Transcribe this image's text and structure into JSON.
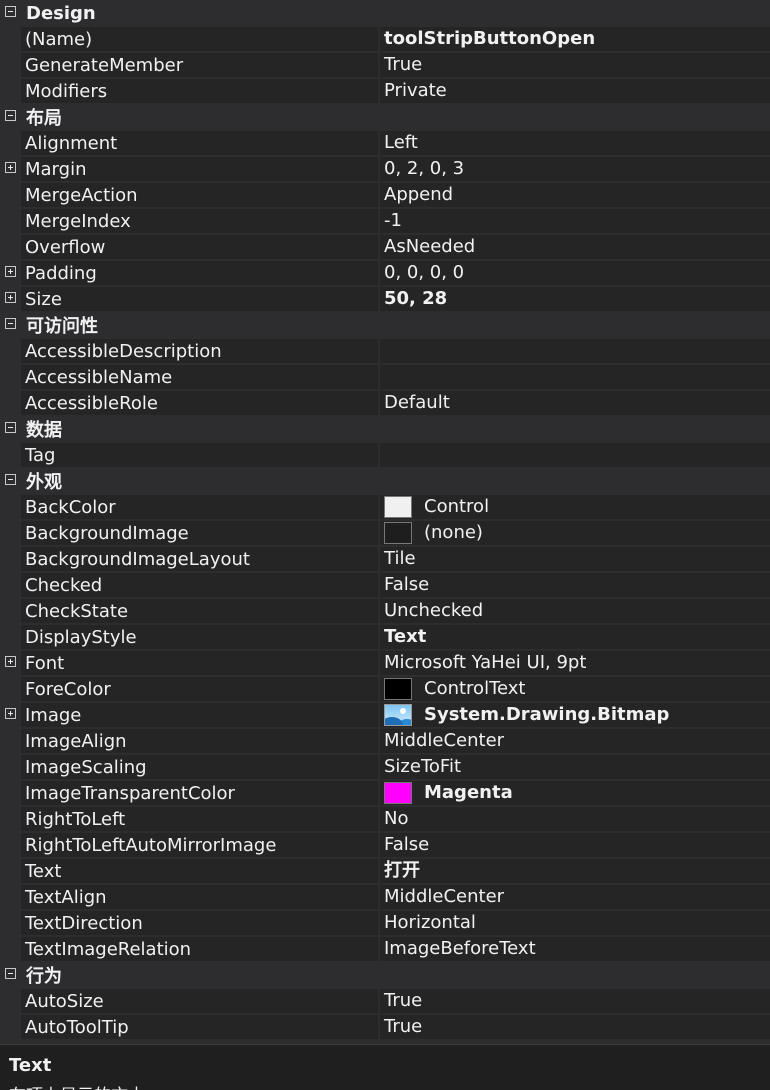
{
  "categories": [
    {
      "label": "Design",
      "props": [
        {
          "name": "(Name)",
          "value": "toolStripButtonOpen",
          "bold": true
        },
        {
          "name": "GenerateMember",
          "value": "True"
        },
        {
          "name": "Modifiers",
          "value": "Private"
        }
      ]
    },
    {
      "label": "布局",
      "props": [
        {
          "name": "Alignment",
          "value": "Left"
        },
        {
          "name": "Margin",
          "value": "0, 2, 0, 3",
          "expandable": true
        },
        {
          "name": "MergeAction",
          "value": "Append"
        },
        {
          "name": "MergeIndex",
          "value": "-1"
        },
        {
          "name": "Overflow",
          "value": "AsNeeded"
        },
        {
          "name": "Padding",
          "value": "0, 0, 0, 0",
          "expandable": true
        },
        {
          "name": "Size",
          "value": "50, 28",
          "bold": true,
          "expandable": true
        }
      ]
    },
    {
      "label": "可访问性",
      "props": [
        {
          "name": "AccessibleDescription",
          "value": ""
        },
        {
          "name": "AccessibleName",
          "value": ""
        },
        {
          "name": "AccessibleRole",
          "value": "Default"
        }
      ]
    },
    {
      "label": "数据",
      "props": [
        {
          "name": "Tag",
          "value": ""
        }
      ]
    },
    {
      "label": "外观",
      "props": [
        {
          "name": "BackColor",
          "value": "Control",
          "swatch": "#f0f0f0"
        },
        {
          "name": "BackgroundImage",
          "value": "(none)",
          "swatch": "#1e1e1e"
        },
        {
          "name": "BackgroundImageLayout",
          "value": "Tile"
        },
        {
          "name": "Checked",
          "value": "False"
        },
        {
          "name": "CheckState",
          "value": "Unchecked"
        },
        {
          "name": "DisplayStyle",
          "value": "Text",
          "bold": true
        },
        {
          "name": "Font",
          "value": "Microsoft YaHei UI, 9pt",
          "expandable": true
        },
        {
          "name": "ForeColor",
          "value": "ControlText",
          "swatch": "#000000"
        },
        {
          "name": "Image",
          "value": "System.Drawing.Bitmap",
          "bold": true,
          "expandable": true,
          "icon": "bitmap-icon"
        },
        {
          "name": "ImageAlign",
          "value": "MiddleCenter"
        },
        {
          "name": "ImageScaling",
          "value": "SizeToFit"
        },
        {
          "name": "ImageTransparentColor",
          "value": "Magenta",
          "bold": true,
          "swatch": "#ff00ff"
        },
        {
          "name": "RightToLeft",
          "value": "No"
        },
        {
          "name": "RightToLeftAutoMirrorImage",
          "value": "False"
        },
        {
          "name": "Text",
          "value": "打开",
          "bold": true
        },
        {
          "name": "TextAlign",
          "value": "MiddleCenter"
        },
        {
          "name": "TextDirection",
          "value": "Horizontal"
        },
        {
          "name": "TextImageRelation",
          "value": "ImageBeforeText"
        }
      ]
    },
    {
      "label": "行为",
      "props": [
        {
          "name": "AutoSize",
          "value": "True"
        },
        {
          "name": "AutoToolTip",
          "value": "True"
        }
      ]
    }
  ],
  "description": {
    "title": "Text",
    "text": "在项上显示的文本。"
  },
  "colors": {
    "background": "#252526",
    "category": "#2d2d30",
    "text": "#f1f1f1"
  }
}
